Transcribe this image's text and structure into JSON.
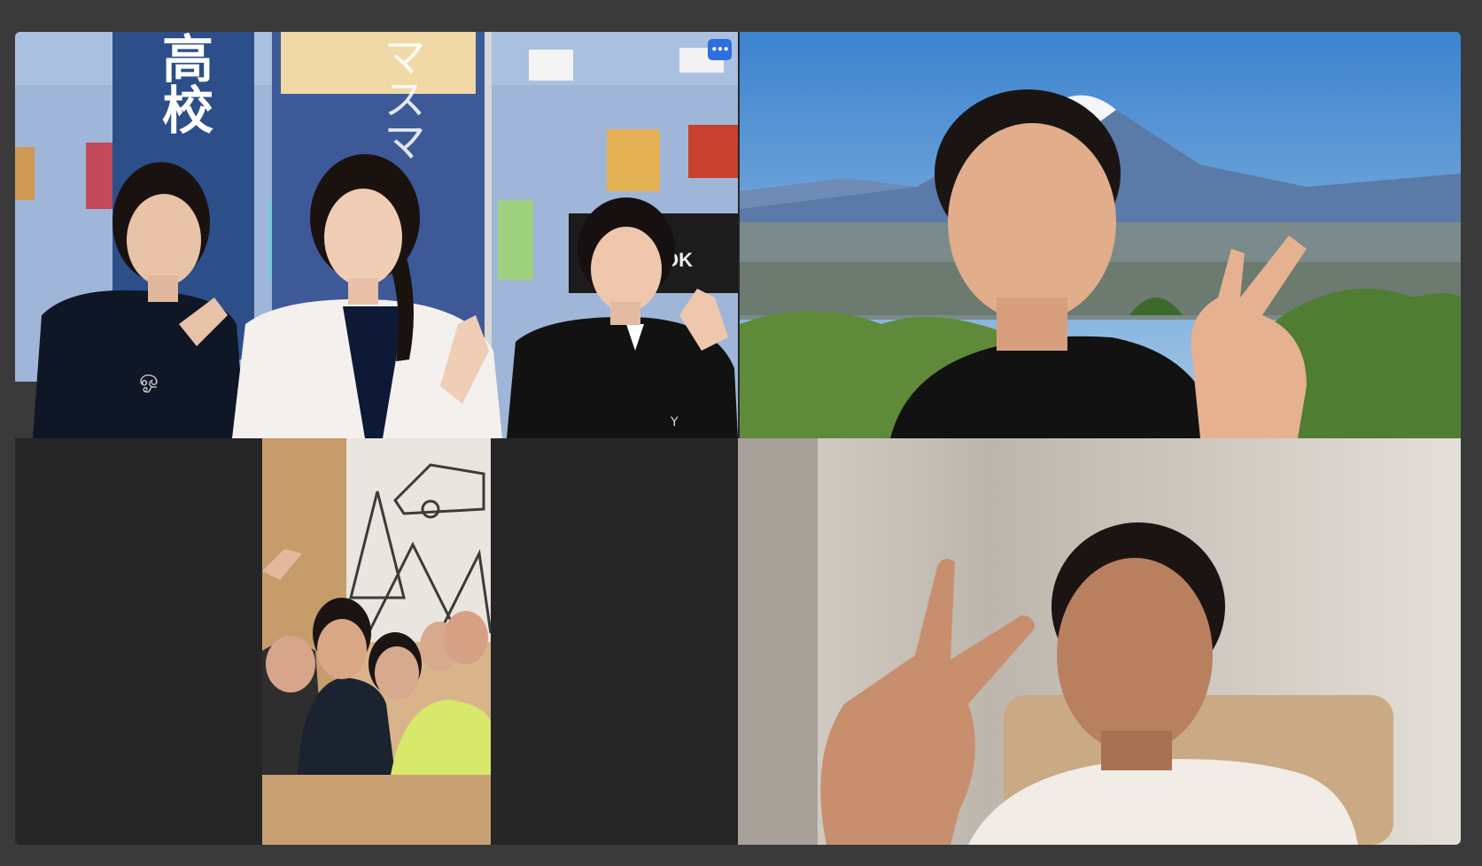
{
  "app": {
    "view": "gallery-view"
  },
  "tiles": [
    {
      "id": "tile-1",
      "scene": "classroom-with-three-students",
      "more_button_label": "•••",
      "banner_text": "土宮高校",
      "banner2_text": "マスマ",
      "wall_sign_text": "OUOK"
    },
    {
      "id": "tile-2",
      "scene": "man-in-front-of-mountain-background",
      "active_speaker": true
    },
    {
      "id": "tile-3",
      "scene": "group-of-five-in-portrait-video"
    },
    {
      "id": "tile-4",
      "scene": "man-in-white-shirt-indoors"
    }
  ],
  "colors": {
    "window_bg": "#3a3a3a",
    "gallery_bg": "#262626",
    "active_speaker_border": "#3fcf4f",
    "more_button_bg": "#2d6ee0"
  },
  "icons": {
    "more": "more-options-icon"
  }
}
